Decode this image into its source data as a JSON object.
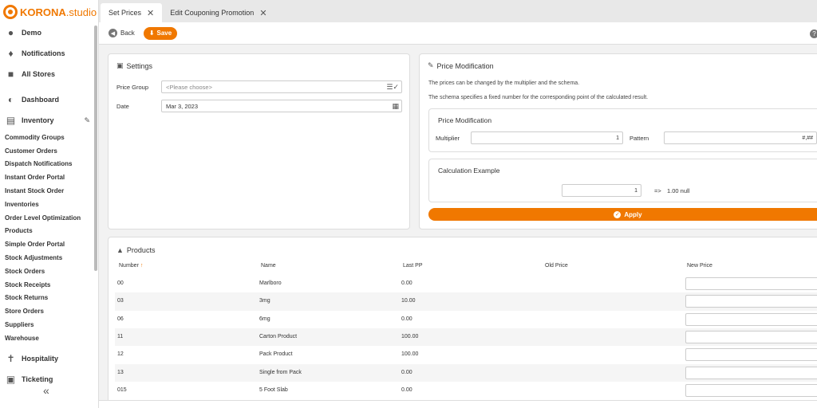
{
  "logo": {
    "brand": "KORONA",
    "suffix": ".studio"
  },
  "sidebar": {
    "top_items": [
      {
        "label": "Demo",
        "icon": "user-icon"
      },
      {
        "label": "Notifications",
        "icon": "bell-icon"
      },
      {
        "label": "All Stores",
        "icon": "store-icon"
      }
    ],
    "dashboard": {
      "label": "Dashboard",
      "icon": "gauge-icon"
    },
    "inventory": {
      "label": "Inventory",
      "icon": "boxes-icon"
    },
    "inventory_items": [
      "Commodity Groups",
      "Customer Orders",
      "Dispatch Notifications",
      "Instant Order Portal",
      "Instant Stock Order",
      "Inventories",
      "Order Level Optimization",
      "Products",
      "Simple Order Portal",
      "Stock Adjustments",
      "Stock Orders",
      "Stock Receipts",
      "Stock Returns",
      "Store Orders",
      "Suppliers",
      "Warehouse"
    ],
    "hospitality": {
      "label": "Hospitality",
      "icon": "utensils-icon"
    },
    "ticketing": {
      "label": "Ticketing",
      "icon": "ticket-icon"
    }
  },
  "tabs": [
    {
      "label": "Set Prices",
      "active": true
    },
    {
      "label": "Edit Couponing Promotion",
      "active": false
    }
  ],
  "toolbar": {
    "back_label": "Back",
    "save_label": "Save",
    "help": "?"
  },
  "settings": {
    "title": "Settings",
    "price_group_label": "Price Group",
    "price_group_value": "<Please choose>",
    "date_label": "Date",
    "date_value": "Mar 3, 2023"
  },
  "price_mod": {
    "title": "Price Modification",
    "desc1": "The prices can be changed by the multiplier and the schema.",
    "desc2": "The schema specifies a fixed number for the corresponding point of the calculated result.",
    "sub_title": "Price Modification",
    "multiplier_label": "Multiplier",
    "multiplier_value": "1",
    "pattern_label": "Pattern",
    "pattern_value": "#,##",
    "calc_title": "Calculation Example",
    "calc_input": "1",
    "calc_arrow": "=>",
    "calc_result": "1.00 null",
    "apply_label": "Apply"
  },
  "products": {
    "title": "Products",
    "columns": [
      "Number",
      "Name",
      "Last PP",
      "Old Price",
      "New Price"
    ],
    "sort_arrow": "↑",
    "rows": [
      {
        "number": "00",
        "name": "Marlboro",
        "last_pp": "0.00",
        "old_price": ""
      },
      {
        "number": "03",
        "name": "3mg",
        "last_pp": "10.00",
        "old_price": ""
      },
      {
        "number": "06",
        "name": "6mg",
        "last_pp": "0.00",
        "old_price": ""
      },
      {
        "number": "11",
        "name": "Carton Product",
        "last_pp": "100.00",
        "old_price": ""
      },
      {
        "number": "12",
        "name": "Pack Product",
        "last_pp": "100.00",
        "old_price": ""
      },
      {
        "number": "13",
        "name": "Single from Pack",
        "last_pp": "0.00",
        "old_price": ""
      },
      {
        "number": "015",
        "name": "5 Foot Slab",
        "last_pp": "0.00",
        "old_price": ""
      }
    ]
  },
  "colors": {
    "accent": "#f07800"
  }
}
